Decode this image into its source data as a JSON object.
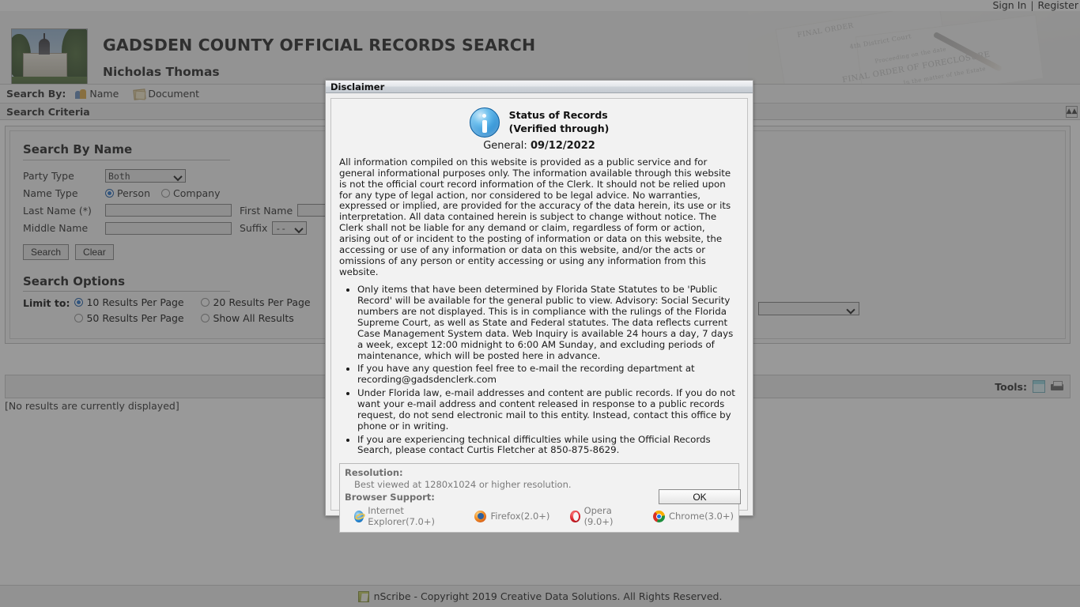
{
  "topbar": {
    "sign_in": "Sign In",
    "separator": "|",
    "register": "Register"
  },
  "header": {
    "title": "GADSDEN COUNTY OFFICIAL RECORDS SEARCH",
    "subtitle": "Nicholas Thomas",
    "logo_alt": "gadsden-county-courthouse-photo",
    "bg_ink": [
      "FINAL ORDER",
      "4th District Court",
      "Proceeding on the date",
      "FINAL ORDER OF FORECLOSURE",
      "In the matter of the Estate"
    ]
  },
  "search_by": {
    "label": "Search By:",
    "items": [
      {
        "label": "Name",
        "icon": "people-icon"
      },
      {
        "label": "Document",
        "icon": "document-icon"
      }
    ]
  },
  "criteria_panel": {
    "title": "Search Criteria",
    "collapse_icon": "collapse-up-icon"
  },
  "search_by_name": {
    "heading": "Search By Name",
    "party_type_label": "Party Type",
    "party_type_value": "Both",
    "party_type_options": [
      "Both"
    ],
    "name_type_label": "Name Type",
    "name_type_options": [
      {
        "label": "Person",
        "selected": true
      },
      {
        "label": "Company",
        "selected": false
      }
    ],
    "last_name_label": "Last Name (*)",
    "last_name_value": "",
    "first_name_label": "First Name",
    "first_name_value": "",
    "middle_name_label": "Middle Name",
    "middle_name_value": "",
    "suffix_label": "Suffix",
    "suffix_value": "--",
    "suffix_options": [
      "--"
    ],
    "search_button": "Search",
    "clear_button": "Clear"
  },
  "search_options": {
    "heading": "Search Options",
    "limit_label": "Limit to:",
    "options": [
      {
        "label": "10 Results Per Page",
        "selected": true
      },
      {
        "label": "20 Results Per Page",
        "selected": false
      },
      {
        "label": "50 Results Per Page",
        "selected": false
      },
      {
        "label": "Show All Results",
        "selected": false
      }
    ]
  },
  "results": {
    "tools_label": "Tools:",
    "tool_icons": [
      "notepad-icon",
      "printer-icon"
    ],
    "empty_message": "[No results are currently displayed]"
  },
  "footer": {
    "icon": "nscribe-icon",
    "text": "nScribe - Copyright 2019 Creative Data Solutions. All Rights Reserved."
  },
  "dialog": {
    "title": "Disclaimer",
    "icon": "info-icon",
    "status_line1": "Status of Records",
    "status_line2": "(Verified through)",
    "general_label": "General:",
    "general_date": "09/12/2022",
    "paragraph": "All information compiled on this website is provided as a public service and for general informational purposes only. The information available through this website is not the official court record information of the Clerk. It should not be relied upon for any type of legal action, nor considered to be legal advice. No warranties, expressed or implied, are provided for the accuracy of the data herein, its use or its interpretation. All data contained herein is subject to change without notice. The Clerk shall not be liable for any demand or claim, regardless of form or action, arising out of or incident to the posting of information or data on this website, the accessing or use of any information or data on this website, and/or the acts or omissions of any person or entity accessing or using any information from this website.",
    "bullets": [
      "Only items that have been determined by Florida State Statutes to be 'Public Record' will be available for the general public to view. Advisory: Social Security numbers are not displayed. This is in compliance with the rulings of the Florida Supreme Court, as well as State and Federal statutes. The data reflects current Case Management System data. Web Inquiry is available 24 hours a day, 7 days a week, except 12:00 midnight to 6:00 AM Sunday, and excluding periods of maintenance, which will be posted here in advance.",
      "If you have any question feel free to e-mail the recording department at recording@gadsdenclerk.com",
      "Under Florida law, e-mail addresses and content are public records. If you do not want your e-mail address and content released in response to a public records request, do not send electronic mail to this entity. Instead, contact this office by phone or in writing.",
      "If you are experiencing technical difficulties while using the Official Records Search, please contact Curtis Fletcher at 850-875-8629."
    ],
    "resolution_label": "Resolution:",
    "resolution_text": "Best viewed at 1280x1024 or higher resolution.",
    "browser_label": "Browser Support:",
    "browsers": [
      {
        "label": "Internet Explorer(7.0+)",
        "icon": "internet-explorer-icon"
      },
      {
        "label": "Firefox(2.0+)",
        "icon": "firefox-icon"
      },
      {
        "label": "Opera (9.0+)",
        "icon": "opera-icon"
      },
      {
        "label": "Chrome(3.0+)",
        "icon": "chrome-icon"
      }
    ],
    "ok_button": "OK"
  },
  "colors": {
    "accent_blue": "#1769c8",
    "page_bg": "#ffffff",
    "panel_bg": "#ededed",
    "dialog_bg": "#f2f2f2",
    "overlay": "#787878"
  }
}
